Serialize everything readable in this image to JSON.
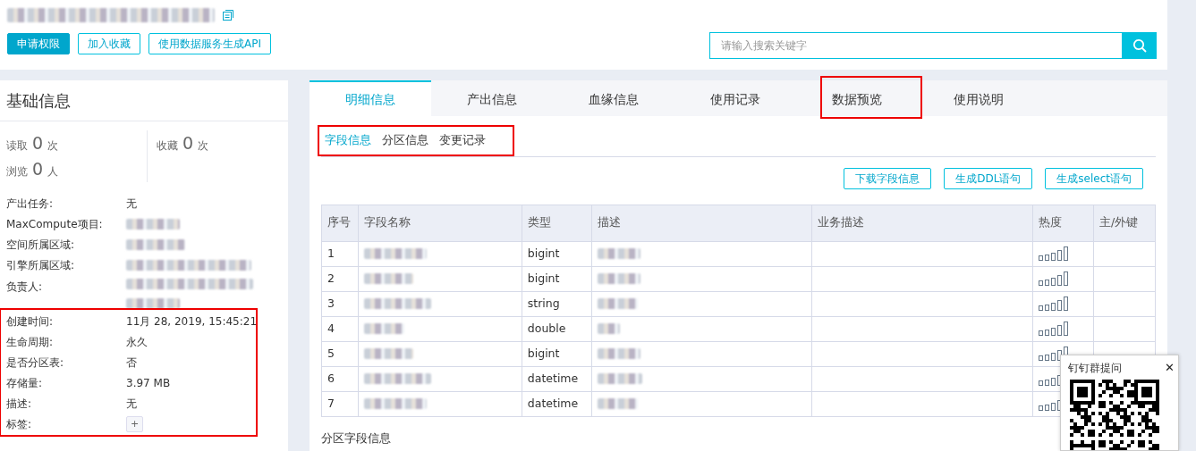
{
  "header": {
    "buttons": [
      {
        "label": "申请权限",
        "kind": "primary"
      },
      {
        "label": "加入收藏",
        "kind": "outline"
      },
      {
        "label": "使用数据服务生成API",
        "kind": "outline"
      }
    ],
    "search": {
      "placeholder": "请输入搜索关键字"
    }
  },
  "basic_info": {
    "title": "基础信息",
    "stats": [
      {
        "label": "读取",
        "value": "0",
        "unit": "次"
      },
      {
        "label": "收藏",
        "value": "0",
        "unit": "次"
      },
      {
        "label": "浏览",
        "value": "0",
        "unit": "人"
      }
    ],
    "field_groups": [
      {
        "highlighted": false,
        "fields": [
          {
            "label": "产出任务:",
            "kind": "text",
            "value": "无"
          },
          {
            "label": "MaxCompute项目:",
            "kind": "blurred"
          },
          {
            "label": "空间所属区域:",
            "kind": "blurred"
          },
          {
            "label": "引擎所属区域:",
            "kind": "blurred"
          },
          {
            "label": "负责人:",
            "kind": "blurred_two_lines"
          }
        ]
      },
      {
        "highlighted": true,
        "fields": [
          {
            "label": "创建时间:",
            "kind": "text",
            "value": "11月 28, 2019, 15:45:21"
          },
          {
            "label": "生命周期:",
            "kind": "text",
            "value": "永久"
          },
          {
            "label": "是否分区表:",
            "kind": "text",
            "value": "否"
          },
          {
            "label": "存储量:",
            "kind": "text",
            "value": "3.97 MB"
          },
          {
            "label": "描述:",
            "kind": "text",
            "value": "无"
          },
          {
            "label": "标签:",
            "kind": "add_button",
            "value": "+"
          }
        ]
      }
    ]
  },
  "tabs": [
    {
      "label": "明细信息",
      "selected": true,
      "highlighted": false
    },
    {
      "label": "产出信息",
      "selected": false,
      "highlighted": false
    },
    {
      "label": "血缘信息",
      "selected": false,
      "highlighted": false
    },
    {
      "label": "使用记录",
      "selected": false,
      "highlighted": false
    },
    {
      "label": "数据预览",
      "selected": false,
      "highlighted": true
    },
    {
      "label": "使用说明",
      "selected": false,
      "highlighted": false
    }
  ],
  "subtabs": {
    "highlighted": true,
    "items": [
      {
        "label": "字段信息",
        "selected": true
      },
      {
        "label": "分区信息",
        "selected": false
      },
      {
        "label": "变更记录",
        "selected": false
      }
    ]
  },
  "actions": [
    "下载字段信息",
    "生成DDL语句",
    "生成select语句"
  ],
  "table": {
    "columns": [
      "序号",
      "字段名称",
      "类型",
      "描述",
      "业务描述",
      "热度",
      "主/外键"
    ],
    "rows": [
      {
        "index": "1",
        "type": "bigint"
      },
      {
        "index": "2",
        "type": "bigint"
      },
      {
        "index": "3",
        "type": "string"
      },
      {
        "index": "4",
        "type": "double"
      },
      {
        "index": "5",
        "type": "bigint"
      },
      {
        "index": "6",
        "type": "datetime"
      },
      {
        "index": "7",
        "type": "datetime"
      }
    ]
  },
  "partition_section": {
    "title": "分区字段信息"
  },
  "popup": {
    "title": "钉钉群提问",
    "close": "✕"
  }
}
